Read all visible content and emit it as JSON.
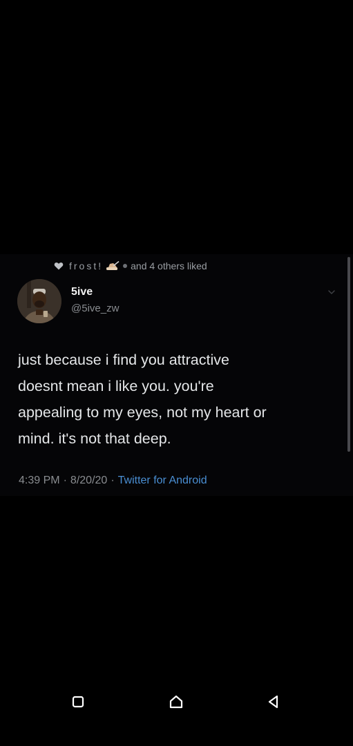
{
  "social_context": {
    "liker": "frost!",
    "suffix": "and 4 others liked"
  },
  "author": {
    "display_name": "5ive",
    "handle": "@5ive_zw"
  },
  "tweet": {
    "lines": [
      "just because i find you attractive",
      "doesnt mean i like you. you're",
      "appealing to my eyes,  not my heart or",
      "mind. it's not that deep."
    ]
  },
  "meta": {
    "time": "4:39 PM",
    "date": "8/20/20",
    "separator": "·",
    "source": "Twitter for Android"
  },
  "nav": {
    "recents": "square-icon",
    "home": "home-icon",
    "back": "back-triangle-icon"
  },
  "colors": {
    "background": "#000000",
    "text": "#e4e6e8",
    "muted": "#8a8d91",
    "link": "#4a8fd4"
  }
}
